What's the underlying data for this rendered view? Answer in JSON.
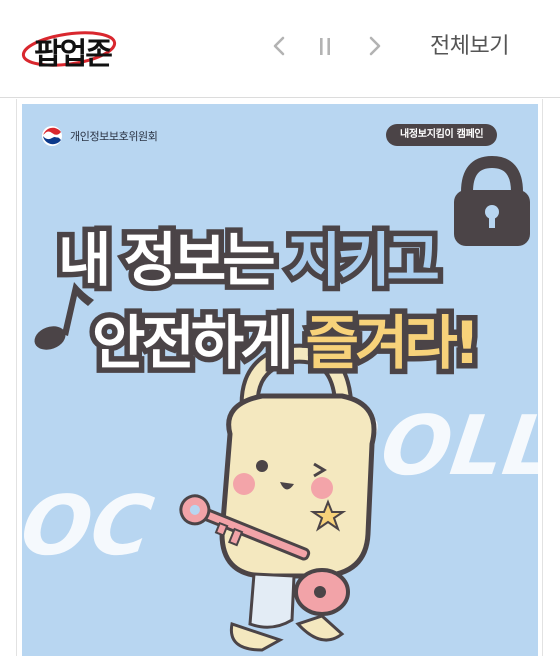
{
  "header": {
    "logo_text": "팝업존",
    "controls": {
      "prev_icon": "chevron-left-icon",
      "pause_icon": "pause-icon",
      "next_icon": "chevron-right-icon"
    },
    "view_all_label": "전체보기"
  },
  "banner": {
    "org_name": "개인정보보호위원회",
    "campaign_badge": "내정보지킴이 캠페인",
    "headline_line1_part1": "내 정보는 ",
    "headline_line1_part2": "지키고",
    "headline_line2_part1": "안전하게 ",
    "headline_line2_part2": "즐겨라!",
    "bg_text_left": "LOC",
    "bg_text_right": "ROLL",
    "colors": {
      "background": "#b8d6f1",
      "outline": "#4b4447",
      "highlight_yellow": "#f7d27a",
      "logo_circle": "#d9272e"
    }
  }
}
